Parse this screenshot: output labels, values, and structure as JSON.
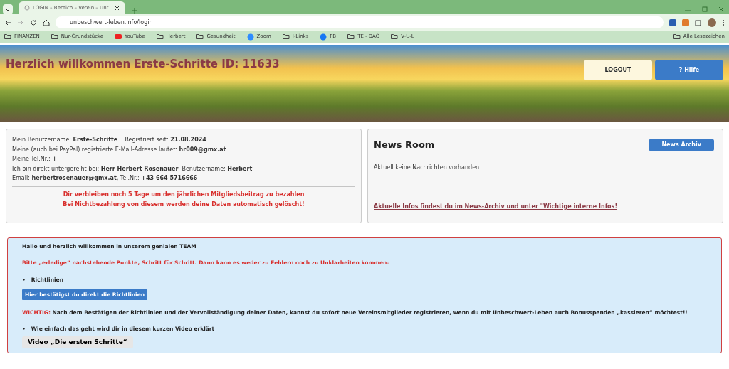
{
  "browser": {
    "tab_title": "LOGIN – Bereich – Verein – Unt",
    "url": "unbeschwert-leben.info/login",
    "bookmarks": [
      {
        "label": "FINANZEN",
        "kind": "folder"
      },
      {
        "label": "Nur-Grundstücke",
        "kind": "folder"
      },
      {
        "label": "YouTube",
        "kind": "youtube"
      },
      {
        "label": "Herbert",
        "kind": "folder"
      },
      {
        "label": "Gesundheit",
        "kind": "folder"
      },
      {
        "label": "Zoom",
        "kind": "zoom"
      },
      {
        "label": "I-Links",
        "kind": "folder"
      },
      {
        "label": "FB",
        "kind": "facebook"
      },
      {
        "label": "TE - DAO",
        "kind": "folder"
      },
      {
        "label": "V-U-L",
        "kind": "folder"
      }
    ],
    "all_bookmarks": "Alle Lesezeichen"
  },
  "header": {
    "title": "Herzlich willkommen Erste-Schritte ID: 11633",
    "logout": "LOGOUT",
    "help": "? Hilfe"
  },
  "profile": {
    "lines": [
      "Mein Benutzername: **Erste-Schritte**    Registriert seit: **21.08.2024**",
      "Meine (auch bei PayPal) registrierte E-Mail-Adresse lautet: **hr009@gmx.at**",
      "Meine Tel.Nr.: **+**",
      "Ich bin direkt untergereiht bei: **Herr Herbert Rosenauer**, Benutzername: **Herbert**",
      "Email: **herbertrosenauer@gmx.at**, Tel.Nr.: **+43 664 5716666**"
    ],
    "warning": [
      "Dir verbleiben noch 5 Tage um den jährlichen Mitgliedsbeitrag zu bezahlen",
      "Bei Nichtbezahlung von diesem werden deine Daten automatisch gelöscht!"
    ]
  },
  "news": {
    "title": "News Room",
    "archive_button": "News Archiv",
    "message": "Aktuell keine Nachrichten vorhanden...",
    "link": "Aktuelle Infos findest du im News-Archiv und unter \"Wichtige interne Infos!"
  },
  "team": {
    "greeting": "Hallo und herzlich willkommen in unserem genialen TEAM",
    "instruction": "Bitte „erledige“ nachstehende Punkte, Schritt für Schritt. Dann kann es weder zu Fehlern noch zu Unklarheiten kommen:",
    "bullet_1": "•",
    "item_1": "Richtlinien",
    "confirm_button": "Hier bestätigst du direkt die Richtlinien",
    "important_label": "WICHTIG:",
    "important_text": "Nach dem Bestätigen der Richtlinien und der Vervollständigung deiner Daten, kannst du sofort neue Vereinsmitglieder registrieren, wenn du mit Unbeschwert-Leben auch Bonusspenden „kassieren“ möchtest!!",
    "bullet_2": "•",
    "item_2": "Wie einfach das geht wird dir in diesem kurzen Video erklärt",
    "video_button": "Video „Die ersten Schritte“"
  }
}
